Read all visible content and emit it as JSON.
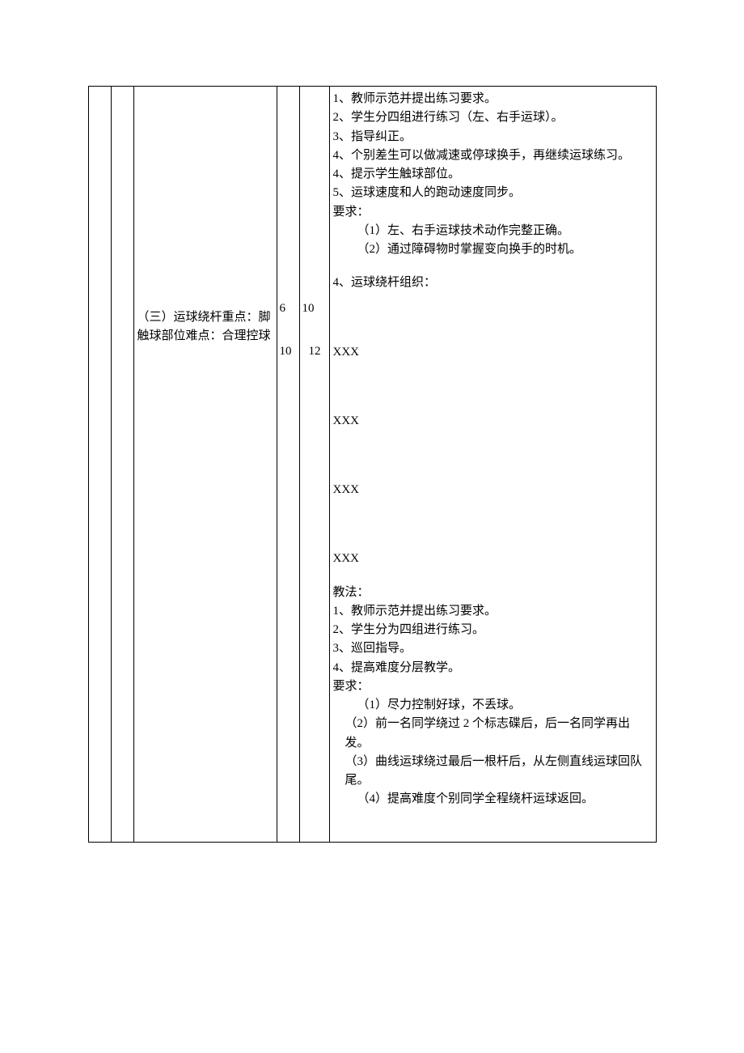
{
  "col3": {
    "content": "（三）运球绕杆重点：脚触球部位难点：合理控球"
  },
  "col4": {
    "v1": "6",
    "v2": "10"
  },
  "col5": {
    "v1": "10",
    "v2": "12"
  },
  "col6": {
    "sectionA": {
      "l1": "1、教师示范并提出练习要求。",
      "l2": "2、学生分四组进行练习（左、右手运球）。",
      "l3": "3、指导纠正。",
      "l4": "4、个别差生可以做减速或停球换手，再继续运球练习。",
      "l5": "4、提示学生触球部位。",
      "l6": "5、运球速度和人的跑动速度同步。",
      "reqLabel": "要求：",
      "r1": "（1）左、右手运球技术动作完整正确。",
      "r2": "（2）通过障碍物时掌握变向换手的时机。"
    },
    "orgLabel": "4、运球绕杆组织：",
    "group1": "XXX",
    "group2": "XXX",
    "group3": "XXX",
    "group4": "XXX",
    "sectionB": {
      "tLabel": "教法：",
      "t1": "1、教师示范并提出练习要求。",
      "t2": "2、学生分为四组进行练习。",
      "t3": "3、巡回指导。",
      "t4": "4、提高难度分层教学。",
      "reqLabel": "要求：",
      "r1": "（1）尽力控制好球，不丢球。",
      "r2": "（2）前一名同学绕过 2 个标志碟后，后一名同学再出发。",
      "r3": "（3）曲线运球绕过最后一根杆后，从左侧直线运球回队尾。",
      "r4": "（4）提高难度个别同学全程绕杆运球返回。"
    }
  }
}
